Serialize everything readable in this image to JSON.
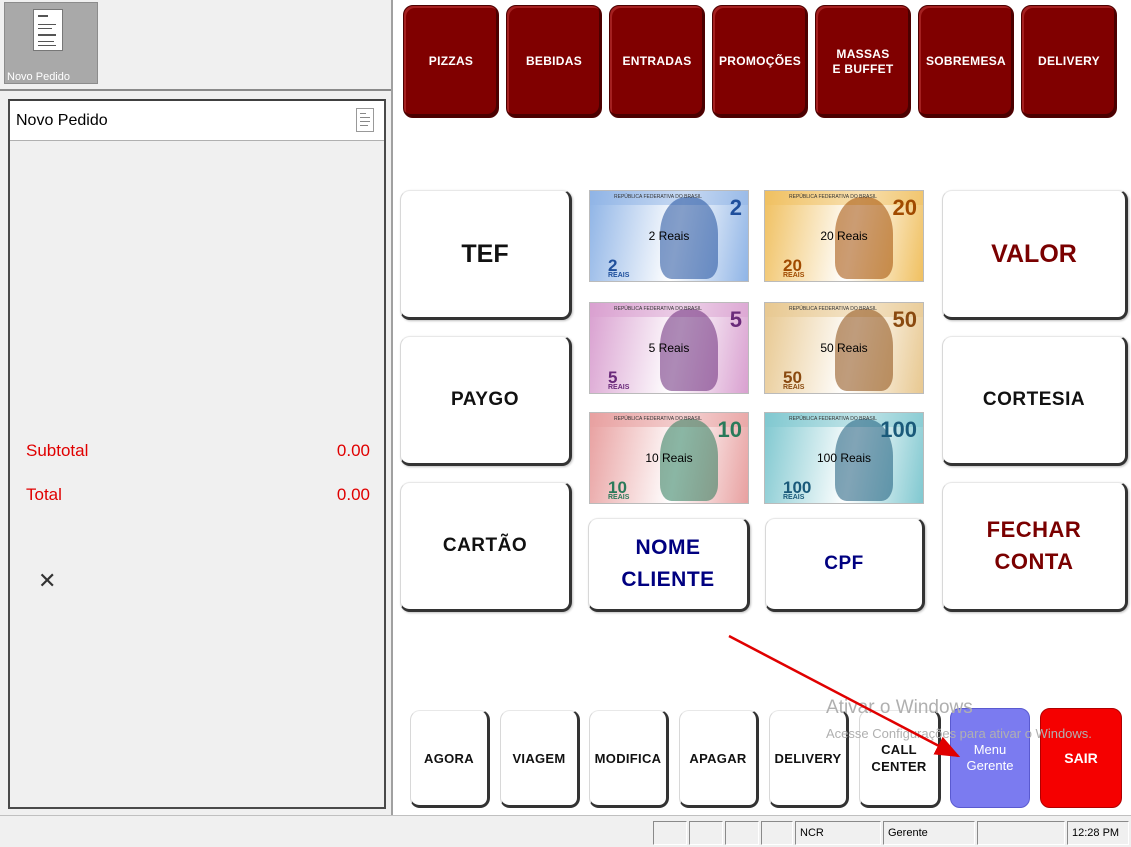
{
  "order_thumbnail": {
    "label": "Novo Pedido",
    "icon": "document-icon"
  },
  "order": {
    "title": "Novo Pedido",
    "subtotal_label": "Subtotal",
    "subtotal_value": "0.00",
    "total_label": "Total",
    "total_value": "0.00",
    "close_glyph": "✕"
  },
  "categories": [
    "PIZZAS",
    "BEBIDAS",
    "ENTRADAS",
    "PROMOÇÕES",
    "MASSAS\nE BUFFET",
    "SOBREMESA",
    "DELIVERY"
  ],
  "payment": {
    "tef": "TEF",
    "paygo": "PAYGO",
    "cartao": "CARTÃO",
    "valor": "VALOR",
    "cortesia": "CORTESIA",
    "fechar_conta": "FECHAR\nCONTA",
    "nome_cliente": "NOME\nCLIENTE",
    "cpf": "CPF"
  },
  "notes": [
    {
      "caption": "2 Reais",
      "denom": "2",
      "color": "#8fb4e6",
      "accent": "#1f4f9c"
    },
    {
      "caption": "20 Reais",
      "denom": "20",
      "color": "#f0c060",
      "accent": "#a04a00"
    },
    {
      "caption": "5 Reais",
      "denom": "5",
      "color": "#d9a0d0",
      "accent": "#6a2a7a"
    },
    {
      "caption": "50 Reais",
      "denom": "50",
      "color": "#e8c890",
      "accent": "#8a4a10"
    },
    {
      "caption": "10 Reais",
      "denom": "10",
      "color": "#e8a0a0",
      "accent": "#2a7a5a"
    },
    {
      "caption": "100 Reais",
      "denom": "100",
      "color": "#80c8d0",
      "accent": "#1a5a7a"
    }
  ],
  "note_small_text": {
    "reais": "REAIS",
    "republica": "REPÚBLICA FEDERATIVA DO BRASIL"
  },
  "functions": [
    "AGORA",
    "VIAGEM",
    "MODIFICA",
    "APAGAR",
    "DELIVERY",
    "CALL\nCENTER"
  ],
  "menu_gerente": "Menu\nGerente",
  "sair": "SAIR",
  "watermark": {
    "title": "Ativar o Windows",
    "subtitle": "Acesse Configurações para ativar o Windows."
  },
  "statusbar": {
    "terminal": "NCR",
    "user": "Gerente",
    "time": "12:28 PM"
  },
  "colors": {
    "category_bg": "#800000",
    "sum_text": "#e00000",
    "menu_gerente_bg": "#7b7bf0",
    "sair_bg": "#f50000",
    "annotation_arrow": "#e00000"
  }
}
